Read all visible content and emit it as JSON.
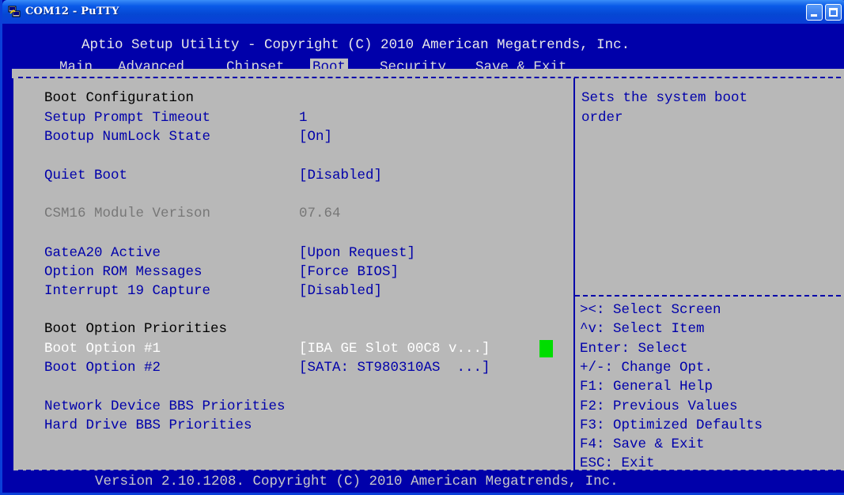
{
  "window": {
    "title": "COM12 - PuTTY",
    "minimize_icon": "minimize-icon",
    "maximize_icon": "maximize-icon",
    "app_icon": "putty-icon"
  },
  "bios": {
    "header": "Aptio Setup Utility - Copyright (C) 2010 American Megatrends, Inc.",
    "menu": [
      "Main",
      "Advanced",
      "Chipset",
      "Boot",
      "Security",
      "Save & Exit"
    ],
    "active_menu": "Boot",
    "section_title": "Boot Configuration",
    "rows": [
      {
        "label": "Setup Prompt Timeout",
        "value": "1"
      },
      {
        "label": "Bootup NumLock State",
        "value": "[On]"
      },
      {
        "label": "Quiet Boot",
        "value": "[Disabled]"
      },
      {
        "label": "CSM16 Module Verison",
        "value": "07.64"
      },
      {
        "label": "GateA20 Active",
        "value": "[Upon Request]"
      },
      {
        "label": "Option ROM Messages",
        "value": "[Force BIOS]"
      },
      {
        "label": "Interrupt 19 Capture",
        "value": "[Disabled]"
      }
    ],
    "priorities_title": "Boot Option Priorities",
    "boot_options": [
      {
        "label": "Boot Option #1",
        "value": "[IBA GE Slot 00C8 v...]"
      },
      {
        "label": "Boot Option #2",
        "value": "[SATA: ST980310AS  ...]"
      }
    ],
    "submenus": [
      "Network Device BBS Priorities",
      "Hard Drive BBS Priorities"
    ],
    "help_text": [
      "Sets the system boot",
      "order"
    ],
    "keys": [
      "><: Select Screen",
      "^v: Select Item",
      "Enter: Select",
      "+/-: Change Opt.",
      "F1: General Help",
      "F2: Previous Values",
      "F3: Optimized Defaults",
      "F4: Save & Exit",
      "ESC: Exit"
    ],
    "footer": "Version 2.10.1208. Copyright (C) 2010 American Megatrends, Inc."
  }
}
